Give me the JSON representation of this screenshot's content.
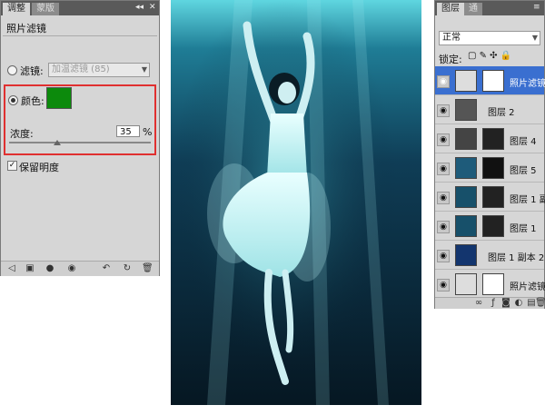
{
  "adjustments": {
    "tab_active": "调整",
    "tab_inactive": "蒙版",
    "title": "照片滤镜",
    "filter_label": "滤镜:",
    "filter_value": "加温滤镜 (85)",
    "color_label": "颜色:",
    "color_value": "#0c8a0c",
    "density_label": "浓度:",
    "density_value": "35",
    "density_unit": "%",
    "preserve_label": "保留明度",
    "preserve_checked": true
  },
  "layers": {
    "tab_label": "图层",
    "tab2_label": "通",
    "blend_mode": "正常",
    "lock_label": "锁定:",
    "items": [
      {
        "name": "照片滤镜"
      },
      {
        "name": "图层 2"
      },
      {
        "name": "图层 4"
      },
      {
        "name": "图层 5"
      },
      {
        "name": "图层 1 副本"
      },
      {
        "name": "图层 1"
      },
      {
        "name": "图层 1 副本 2"
      },
      {
        "name": "照片滤镜"
      }
    ],
    "bottom_icons": [
      "link-icon",
      "fx-icon",
      "mask-icon",
      "adjust-icon",
      "folder-icon",
      "new-layer-icon",
      "trash-icon"
    ]
  }
}
